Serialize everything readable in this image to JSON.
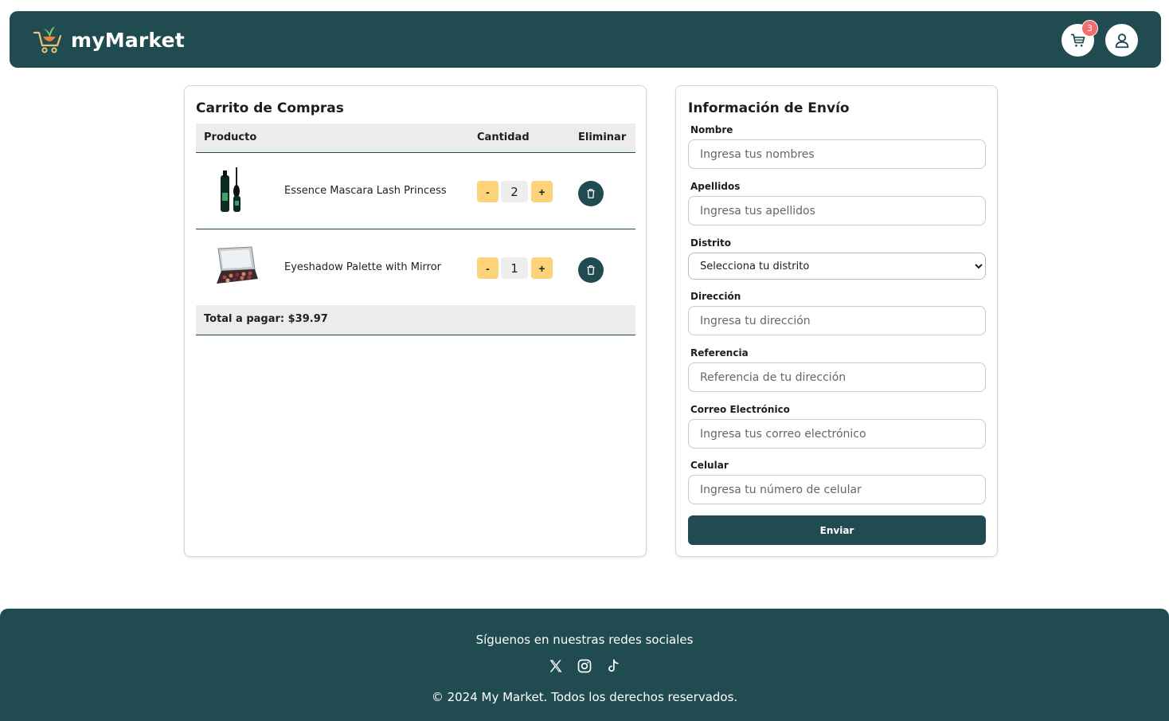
{
  "header": {
    "brand": "myMarket",
    "cart_count": "3",
    "icons": {
      "logo": "shopping-cart-carrot-logo",
      "cart": "cart-icon",
      "user": "user-icon"
    }
  },
  "cart": {
    "title": "Carrito de Compras",
    "columns": {
      "product": "Producto",
      "quantity": "Cantidad",
      "remove": "Eliminar"
    },
    "items": [
      {
        "name": "Essence Mascara Lash Princess",
        "qty": "2",
        "minus": "-",
        "plus": "+",
        "image": "mascara-image"
      },
      {
        "name": "Eyeshadow Palette with Mirror",
        "qty": "1",
        "minus": "-",
        "plus": "+",
        "image": "eyeshadow-palette-image"
      }
    ],
    "total": "Total a pagar: $39.97"
  },
  "shipping": {
    "title": "Información de Envío",
    "fields": {
      "nombre": {
        "label": "Nombre",
        "placeholder": "Ingresa tus nombres"
      },
      "apellidos": {
        "label": "Apellidos",
        "placeholder": "Ingresa tus apellidos"
      },
      "distrito": {
        "label": "Distrito",
        "selected": "Selecciona tu distrito"
      },
      "direccion": {
        "label": "Dirección",
        "placeholder": "Ingresa tu dirección"
      },
      "referencia": {
        "label": "Referencia",
        "placeholder": "Referencia de tu dirección"
      },
      "correo": {
        "label": "Correo Electrónico",
        "placeholder": "Ingresa tus correo electrónico"
      },
      "celular": {
        "label": "Celular",
        "placeholder": "Ingresa tu número de celular"
      }
    },
    "submit": "Enviar"
  },
  "footer": {
    "follow": "Síguenos en nuestras redes sociales",
    "socials": [
      "x-icon",
      "instagram-icon",
      "tiktok-icon"
    ],
    "copyright": "© 2024 My Market. Todos los derechos reservados."
  },
  "colors": {
    "primary": "#204b50",
    "accent": "#fcd27a",
    "badge": "#f26d6d"
  }
}
